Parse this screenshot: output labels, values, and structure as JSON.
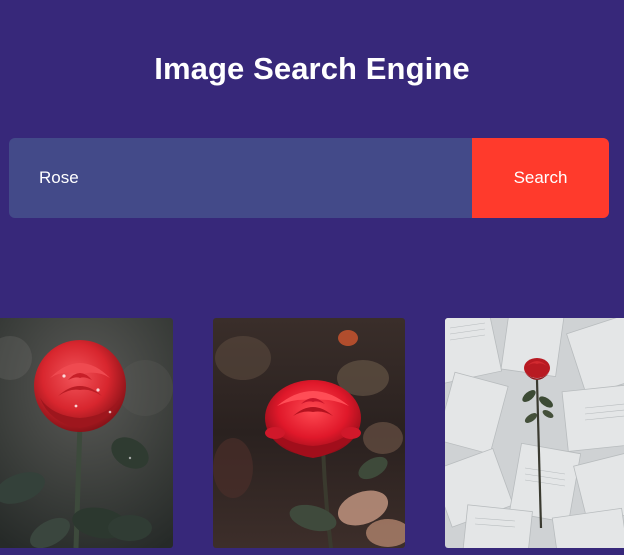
{
  "header": {
    "title": "Image Search Engine"
  },
  "search": {
    "value": "Rose",
    "button_label": "Search"
  },
  "results": [
    {
      "name": "rose-photo-dewdrops",
      "accent": "#d8262e"
    },
    {
      "name": "rose-photo-dark-garden",
      "accent": "#e0182a"
    },
    {
      "name": "rose-photo-on-book-pages",
      "accent": "#b81a22"
    }
  ],
  "colors": {
    "background": "#37287a",
    "input_background": "#434a89",
    "button_background": "#ff3a2c",
    "text": "#ffffff"
  }
}
